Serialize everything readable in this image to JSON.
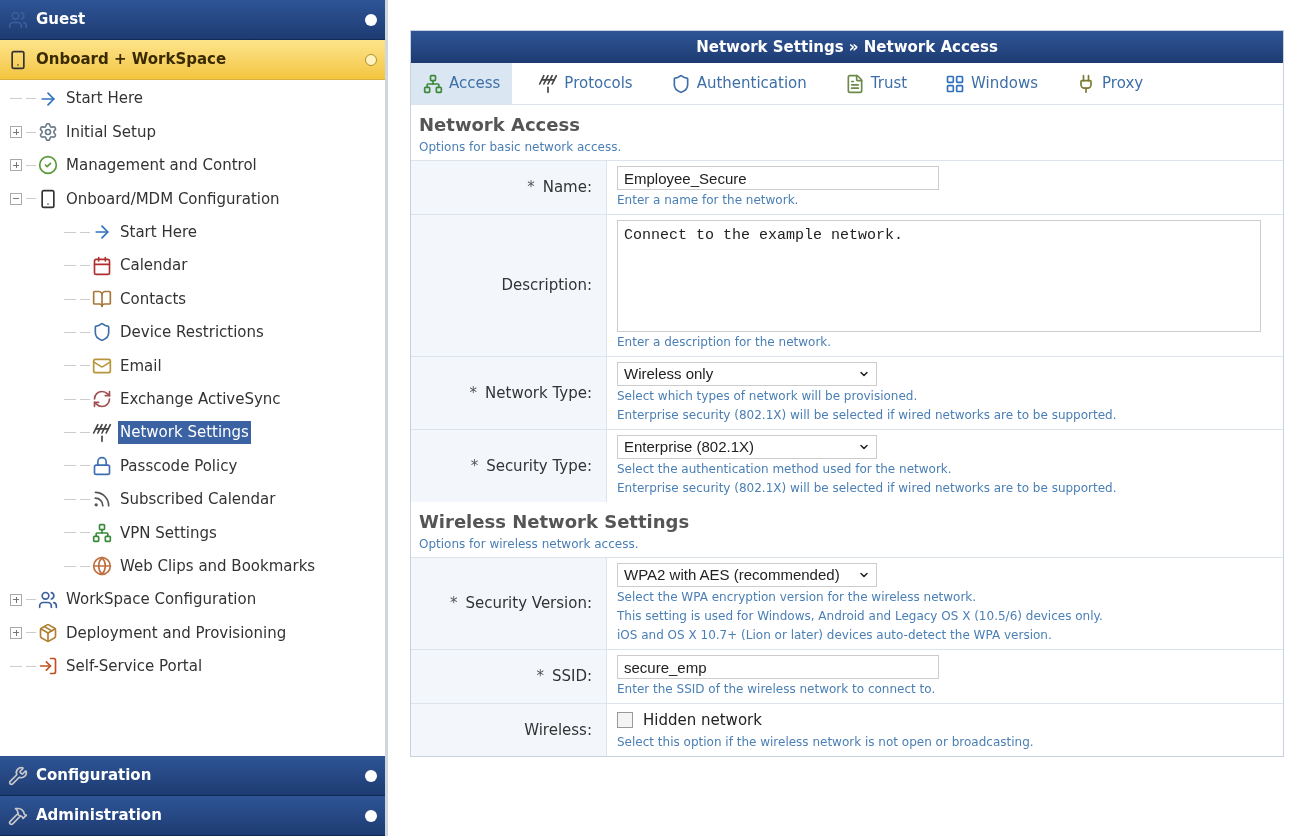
{
  "sidebar": {
    "top_panels": [
      {
        "label": "Guest",
        "selected": false
      },
      {
        "label": "Onboard + WorkSpace",
        "selected": true
      }
    ],
    "tree": [
      {
        "label": "Start Here",
        "selected": false
      },
      {
        "label": "Initial Setup",
        "expanded": false,
        "selected": false
      },
      {
        "label": "Management and Control",
        "expanded": false,
        "selected": false
      },
      {
        "label": "Onboard/MDM Configuration",
        "expanded": true,
        "selected": false,
        "children": [
          {
            "label": "Start Here",
            "selected": false
          },
          {
            "label": "Calendar",
            "selected": false
          },
          {
            "label": "Contacts",
            "selected": false
          },
          {
            "label": "Device Restrictions",
            "selected": false
          },
          {
            "label": "Email",
            "selected": false
          },
          {
            "label": "Exchange ActiveSync",
            "selected": false
          },
          {
            "label": "Network Settings",
            "selected": true
          },
          {
            "label": "Passcode Policy",
            "selected": false
          },
          {
            "label": "Subscribed Calendar",
            "selected": false
          },
          {
            "label": "VPN Settings",
            "selected": false
          },
          {
            "label": "Web Clips and Bookmarks",
            "selected": false
          }
        ]
      },
      {
        "label": "WorkSpace Configuration",
        "expanded": false,
        "selected": false
      },
      {
        "label": "Deployment and Provisioning",
        "expanded": false,
        "selected": false
      },
      {
        "label": "Self-Service Portal",
        "selected": false
      }
    ],
    "bottom_panels": [
      {
        "label": "Configuration",
        "selected": false
      },
      {
        "label": "Administration",
        "selected": false
      }
    ]
  },
  "panel": {
    "title": "Network Settings » Network Access",
    "tabs": [
      {
        "label": "Access",
        "selected": true
      },
      {
        "label": "Protocols",
        "selected": false
      },
      {
        "label": "Authentication",
        "selected": false
      },
      {
        "label": "Trust",
        "selected": false
      },
      {
        "label": "Windows",
        "selected": false
      },
      {
        "label": "Proxy",
        "selected": false
      }
    ],
    "sections": [
      {
        "title": "Network Access",
        "subtitle": "Options for basic network access.",
        "fields": [
          {
            "label": "Name:",
            "required_mark": "*",
            "kind": "text",
            "value": "Employee_Secure",
            "hints": [
              "Enter a name for the network."
            ]
          },
          {
            "label": "Description:",
            "kind": "textarea",
            "value": "Connect to the example network.",
            "hints": [
              "Enter a description for the network."
            ]
          },
          {
            "label": "Network Type:",
            "required_mark": "*",
            "kind": "select",
            "value": "Wireless only",
            "hints": [
              "Select which types of network will be provisioned.",
              "Enterprise security (802.1X) will be selected if wired networks are to be supported."
            ]
          },
          {
            "label": "Security Type:",
            "required_mark": "*",
            "kind": "select",
            "value": "Enterprise (802.1X)",
            "hints": [
              "Select the authentication method used for the network.",
              "Enterprise security (802.1X) will be selected if wired networks are to be supported."
            ]
          }
        ]
      },
      {
        "title": "Wireless Network Settings",
        "subtitle": "Options for wireless network access.",
        "fields": [
          {
            "label": "Security Version:",
            "required_mark": "*",
            "kind": "select",
            "value": "WPA2 with AES (recommended)",
            "hints": [
              "Select the WPA encryption version for the wireless network.",
              "This setting is used for Windows, Android and Legacy OS X (10.5/6) devices only.",
              "iOS and OS X 10.7+ (Lion or later) devices auto-detect the WPA version."
            ]
          },
          {
            "label": "SSID:",
            "required_mark": "*",
            "kind": "text",
            "value": "secure_emp",
            "hints": [
              "Enter the SSID of the wireless network to connect to."
            ]
          },
          {
            "label": "Wireless:",
            "kind": "checkbox",
            "value": "Hidden network",
            "checked": false,
            "hints": [
              "Select this option if the wireless network is not open or broadcasting."
            ]
          }
        ]
      }
    ]
  }
}
